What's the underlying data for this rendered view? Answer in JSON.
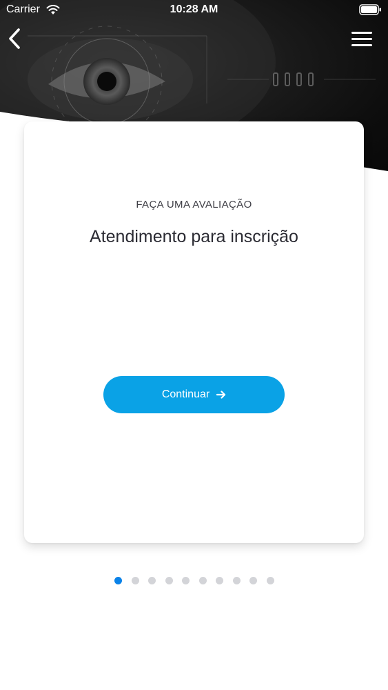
{
  "status_bar": {
    "carrier": "Carrier",
    "time": "10:28 AM"
  },
  "nav": {
    "back_icon": "chevron-left-icon",
    "menu_icon": "hamburger-menu-icon"
  },
  "card": {
    "eyebrow": "FAÇA UMA AVALIAÇÃO",
    "title": "Atendimento para inscrição",
    "button_label": "Continuar",
    "button_icon": "arrow-right-icon"
  },
  "pagination": {
    "total": 10,
    "active_index": 0
  },
  "colors": {
    "accent": "#0aa2e6",
    "active_dot": "#0a82e8",
    "inactive_dot": "#d3d4d8",
    "hero_bg": "#111111"
  }
}
